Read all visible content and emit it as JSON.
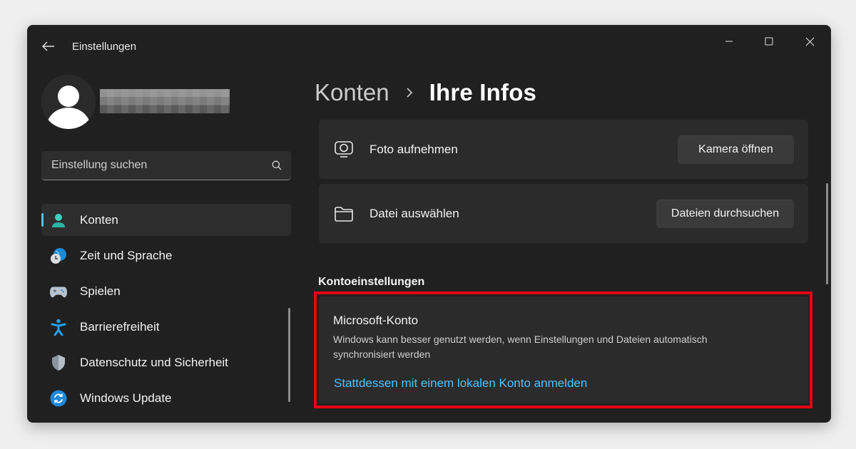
{
  "window": {
    "title": "Einstellungen"
  },
  "profile": {
    "name": ""
  },
  "search": {
    "placeholder": "Einstellung suchen"
  },
  "sidebar": {
    "items": [
      {
        "label": "Konten",
        "icon": "account-icon",
        "active": true
      },
      {
        "label": "Zeit und Sprache",
        "icon": "globe-clock-icon"
      },
      {
        "label": "Spielen",
        "icon": "gamepad-icon"
      },
      {
        "label": "Barrierefreiheit",
        "icon": "accessibility-icon"
      },
      {
        "label": "Datenschutz und Sicherheit",
        "icon": "shield-icon"
      },
      {
        "label": "Windows Update",
        "icon": "update-icon"
      }
    ]
  },
  "breadcrumb": {
    "parent": "Konten",
    "current": "Ihre Infos"
  },
  "photo": {
    "take": {
      "label": "Foto aufnehmen",
      "button": "Kamera öffnen"
    },
    "file": {
      "label": "Datei auswählen",
      "button": "Dateien durchsuchen"
    }
  },
  "account_settings": {
    "title": "Kontoeinstellungen",
    "microsoft": {
      "title": "Microsoft-Konto",
      "description": "Windows kann besser genutzt werden, wenn Einstellungen und Dateien automatisch synchronisiert werden",
      "link": "Stattdessen mit einem lokalen Konto anmelden"
    }
  },
  "colors": {
    "accent": "#4cc2ff",
    "highlight": "#e30613",
    "window_bg": "#202020",
    "card_bg": "#2b2b2b"
  }
}
